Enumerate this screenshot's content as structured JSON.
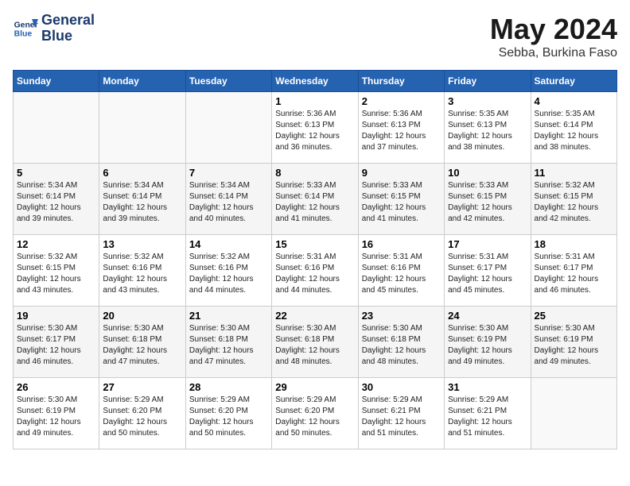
{
  "logo": {
    "line1": "General",
    "line2": "Blue"
  },
  "title": "May 2024",
  "subtitle": "Sebba, Burkina Faso",
  "days_header": [
    "Sunday",
    "Monday",
    "Tuesday",
    "Wednesday",
    "Thursday",
    "Friday",
    "Saturday"
  ],
  "weeks": [
    [
      {
        "num": "",
        "info": ""
      },
      {
        "num": "",
        "info": ""
      },
      {
        "num": "",
        "info": ""
      },
      {
        "num": "1",
        "info": "Sunrise: 5:36 AM\nSunset: 6:13 PM\nDaylight: 12 hours\nand 36 minutes."
      },
      {
        "num": "2",
        "info": "Sunrise: 5:36 AM\nSunset: 6:13 PM\nDaylight: 12 hours\nand 37 minutes."
      },
      {
        "num": "3",
        "info": "Sunrise: 5:35 AM\nSunset: 6:13 PM\nDaylight: 12 hours\nand 38 minutes."
      },
      {
        "num": "4",
        "info": "Sunrise: 5:35 AM\nSunset: 6:14 PM\nDaylight: 12 hours\nand 38 minutes."
      }
    ],
    [
      {
        "num": "5",
        "info": "Sunrise: 5:34 AM\nSunset: 6:14 PM\nDaylight: 12 hours\nand 39 minutes."
      },
      {
        "num": "6",
        "info": "Sunrise: 5:34 AM\nSunset: 6:14 PM\nDaylight: 12 hours\nand 39 minutes."
      },
      {
        "num": "7",
        "info": "Sunrise: 5:34 AM\nSunset: 6:14 PM\nDaylight: 12 hours\nand 40 minutes."
      },
      {
        "num": "8",
        "info": "Sunrise: 5:33 AM\nSunset: 6:14 PM\nDaylight: 12 hours\nand 41 minutes."
      },
      {
        "num": "9",
        "info": "Sunrise: 5:33 AM\nSunset: 6:15 PM\nDaylight: 12 hours\nand 41 minutes."
      },
      {
        "num": "10",
        "info": "Sunrise: 5:33 AM\nSunset: 6:15 PM\nDaylight: 12 hours\nand 42 minutes."
      },
      {
        "num": "11",
        "info": "Sunrise: 5:32 AM\nSunset: 6:15 PM\nDaylight: 12 hours\nand 42 minutes."
      }
    ],
    [
      {
        "num": "12",
        "info": "Sunrise: 5:32 AM\nSunset: 6:15 PM\nDaylight: 12 hours\nand 43 minutes."
      },
      {
        "num": "13",
        "info": "Sunrise: 5:32 AM\nSunset: 6:16 PM\nDaylight: 12 hours\nand 43 minutes."
      },
      {
        "num": "14",
        "info": "Sunrise: 5:32 AM\nSunset: 6:16 PM\nDaylight: 12 hours\nand 44 minutes."
      },
      {
        "num": "15",
        "info": "Sunrise: 5:31 AM\nSunset: 6:16 PM\nDaylight: 12 hours\nand 44 minutes."
      },
      {
        "num": "16",
        "info": "Sunrise: 5:31 AM\nSunset: 6:16 PM\nDaylight: 12 hours\nand 45 minutes."
      },
      {
        "num": "17",
        "info": "Sunrise: 5:31 AM\nSunset: 6:17 PM\nDaylight: 12 hours\nand 45 minutes."
      },
      {
        "num": "18",
        "info": "Sunrise: 5:31 AM\nSunset: 6:17 PM\nDaylight: 12 hours\nand 46 minutes."
      }
    ],
    [
      {
        "num": "19",
        "info": "Sunrise: 5:30 AM\nSunset: 6:17 PM\nDaylight: 12 hours\nand 46 minutes."
      },
      {
        "num": "20",
        "info": "Sunrise: 5:30 AM\nSunset: 6:18 PM\nDaylight: 12 hours\nand 47 minutes."
      },
      {
        "num": "21",
        "info": "Sunrise: 5:30 AM\nSunset: 6:18 PM\nDaylight: 12 hours\nand 47 minutes."
      },
      {
        "num": "22",
        "info": "Sunrise: 5:30 AM\nSunset: 6:18 PM\nDaylight: 12 hours\nand 48 minutes."
      },
      {
        "num": "23",
        "info": "Sunrise: 5:30 AM\nSunset: 6:18 PM\nDaylight: 12 hours\nand 48 minutes."
      },
      {
        "num": "24",
        "info": "Sunrise: 5:30 AM\nSunset: 6:19 PM\nDaylight: 12 hours\nand 49 minutes."
      },
      {
        "num": "25",
        "info": "Sunrise: 5:30 AM\nSunset: 6:19 PM\nDaylight: 12 hours\nand 49 minutes."
      }
    ],
    [
      {
        "num": "26",
        "info": "Sunrise: 5:30 AM\nSunset: 6:19 PM\nDaylight: 12 hours\nand 49 minutes."
      },
      {
        "num": "27",
        "info": "Sunrise: 5:29 AM\nSunset: 6:20 PM\nDaylight: 12 hours\nand 50 minutes."
      },
      {
        "num": "28",
        "info": "Sunrise: 5:29 AM\nSunset: 6:20 PM\nDaylight: 12 hours\nand 50 minutes."
      },
      {
        "num": "29",
        "info": "Sunrise: 5:29 AM\nSunset: 6:20 PM\nDaylight: 12 hours\nand 50 minutes."
      },
      {
        "num": "30",
        "info": "Sunrise: 5:29 AM\nSunset: 6:21 PM\nDaylight: 12 hours\nand 51 minutes."
      },
      {
        "num": "31",
        "info": "Sunrise: 5:29 AM\nSunset: 6:21 PM\nDaylight: 12 hours\nand 51 minutes."
      },
      {
        "num": "",
        "info": ""
      }
    ]
  ]
}
